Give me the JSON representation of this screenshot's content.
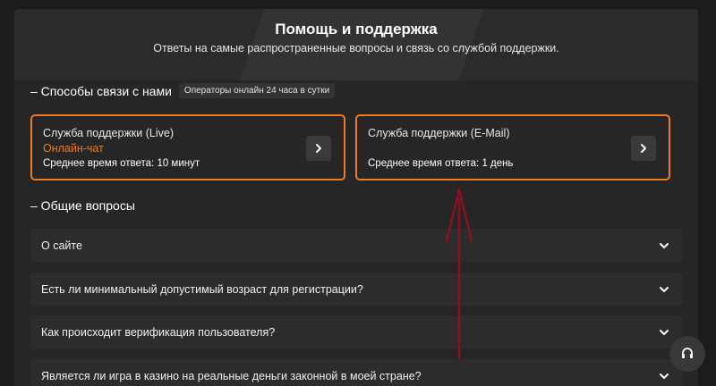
{
  "header": {
    "title": "Помощь и поддержка",
    "subtitle": "Ответы на самые распространенные вопросы и связь со службой поддержки."
  },
  "contact": {
    "title": "– Способы связи с нами",
    "badge": "Операторы онлайн 24 часа в сутки",
    "cards": [
      {
        "title": "Служба поддержки (Live)",
        "subtitle": "Онлайн-чат",
        "response": "Среднее время ответа: 10 минут",
        "icon": "chevron-right-icon"
      },
      {
        "title": "Служба поддержки (E-Mail)",
        "subtitle": "",
        "response": "Среднее время ответа: 1 день",
        "icon": "chevron-right-icon"
      }
    ]
  },
  "faq": {
    "title": "– Общие вопросы",
    "items": [
      {
        "question": "О сайте"
      },
      {
        "question": "Есть ли минимальный допустимый возраст для регистрации?"
      },
      {
        "question": "Как происходит верификация пользователя?"
      },
      {
        "question": "Является ли игра в казино на реальные деньги законной в моей стране?"
      }
    ]
  },
  "fab": {
    "icon": "headset-icon"
  },
  "colors": {
    "accent": "#f07a22",
    "annotation": "#8b1020",
    "background": "#1c1c1c",
    "panel": "#262626"
  }
}
